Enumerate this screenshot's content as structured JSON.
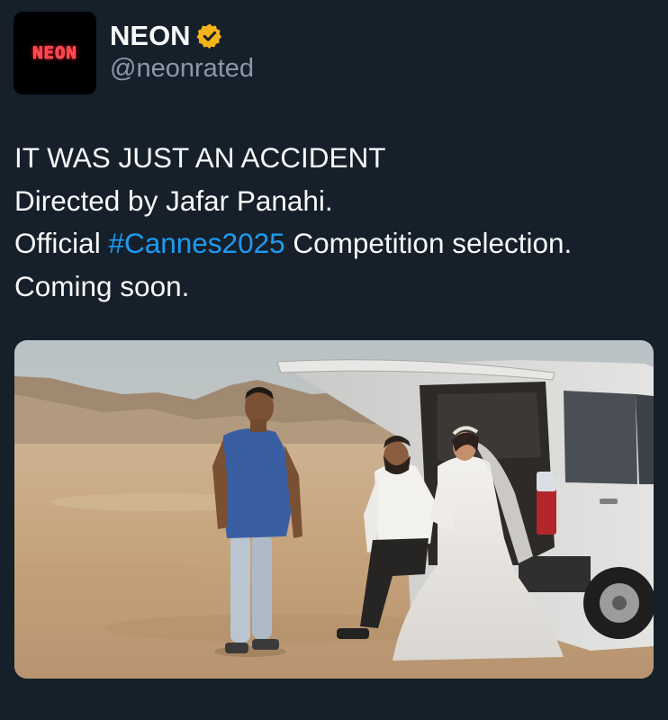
{
  "author": {
    "avatar_text": "NEON",
    "display_name": "NEON",
    "handle": "@neonrated",
    "verified_badge_color": "#f4b318"
  },
  "tweet": {
    "line1": "IT WAS JUST AN ACCIDENT",
    "line2": "Directed by Jafar Panahi.",
    "line3_before": "Official ",
    "line3_hashtag": "#Cannes2025",
    "line3_after": " Competition selection.",
    "line4": "Coming soon."
  },
  "colors": {
    "background": "#15202b",
    "text": "#f7f9f9",
    "secondary": "#8b98a5",
    "link": "#1d9bf0",
    "avatar_bg": "#000000",
    "avatar_neon": "#ff3b45"
  },
  "media": {
    "scene": "desert-van-wedding-photo"
  }
}
